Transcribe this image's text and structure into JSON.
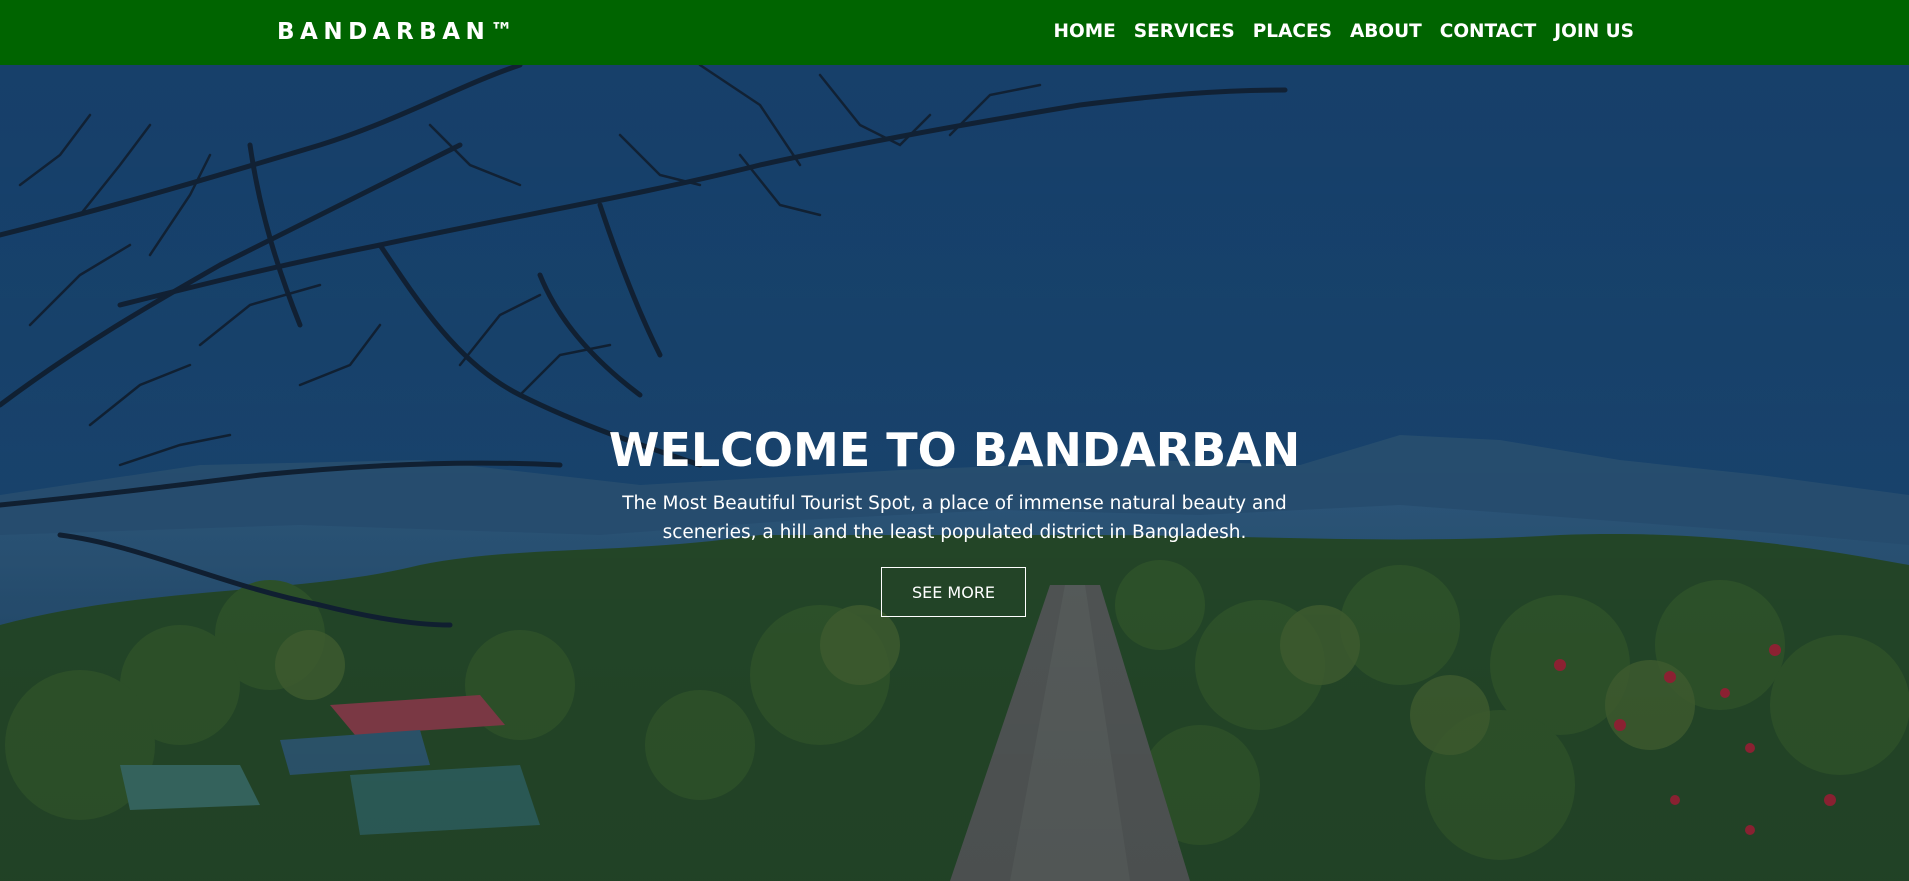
{
  "navbar": {
    "brand": "BANDARBAN™",
    "links": [
      {
        "label": "HOME"
      },
      {
        "label": "SERVICES"
      },
      {
        "label": "PLACES"
      },
      {
        "label": "ABOUT"
      },
      {
        "label": "CONTACT"
      },
      {
        "label": "JOIN US"
      }
    ]
  },
  "hero": {
    "title": "WELCOME TO BANDARBAN",
    "description_line1": "The Most Beautiful Tourist Spot, a place of immense natural beauty and",
    "description_line2": "sceneries, a hill and the least populated district in Bangladesh.",
    "button_label": "SEE MORE"
  },
  "colors": {
    "navbar_bg": "#006400",
    "text": "#ffffff",
    "sky": "#1d4a78"
  }
}
